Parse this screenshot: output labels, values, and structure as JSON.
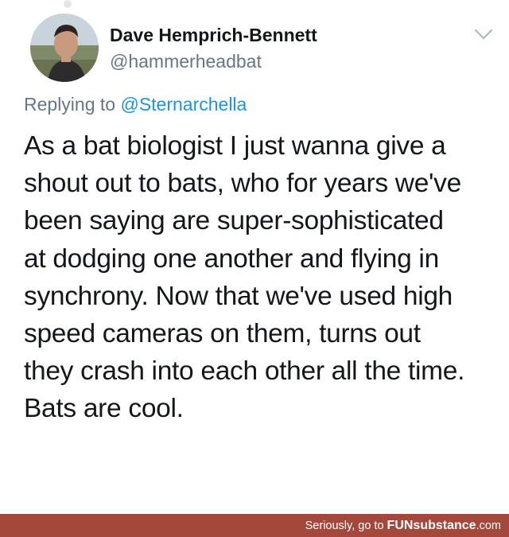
{
  "tweet": {
    "author": {
      "display_name": "Dave Hemprich-Bennett",
      "handle": "@hammerheadbat"
    },
    "reply": {
      "prefix": "Replying to ",
      "mention": "@Sternarchella"
    },
    "text_lines": [
      "As a bat biologist I just wanna give a",
      "shout out to bats, who for years we've",
      "been saying are super-sophisticated",
      "at dodging one another and flying in",
      "synchrony. Now that we've used high",
      "speed cameras on them, turns out",
      "they crash into each other all the time.",
      "Bats are cool."
    ],
    "menu_icon": "chevron-down-icon"
  },
  "watermark": {
    "prefix": "Seriously, go to ",
    "brand": "FUNsubstance",
    "suffix": ".com"
  },
  "colors": {
    "text_primary": "#14171a",
    "text_secondary": "#657786",
    "link": "#1b95e0",
    "footer_bg": "#a5483c"
  }
}
